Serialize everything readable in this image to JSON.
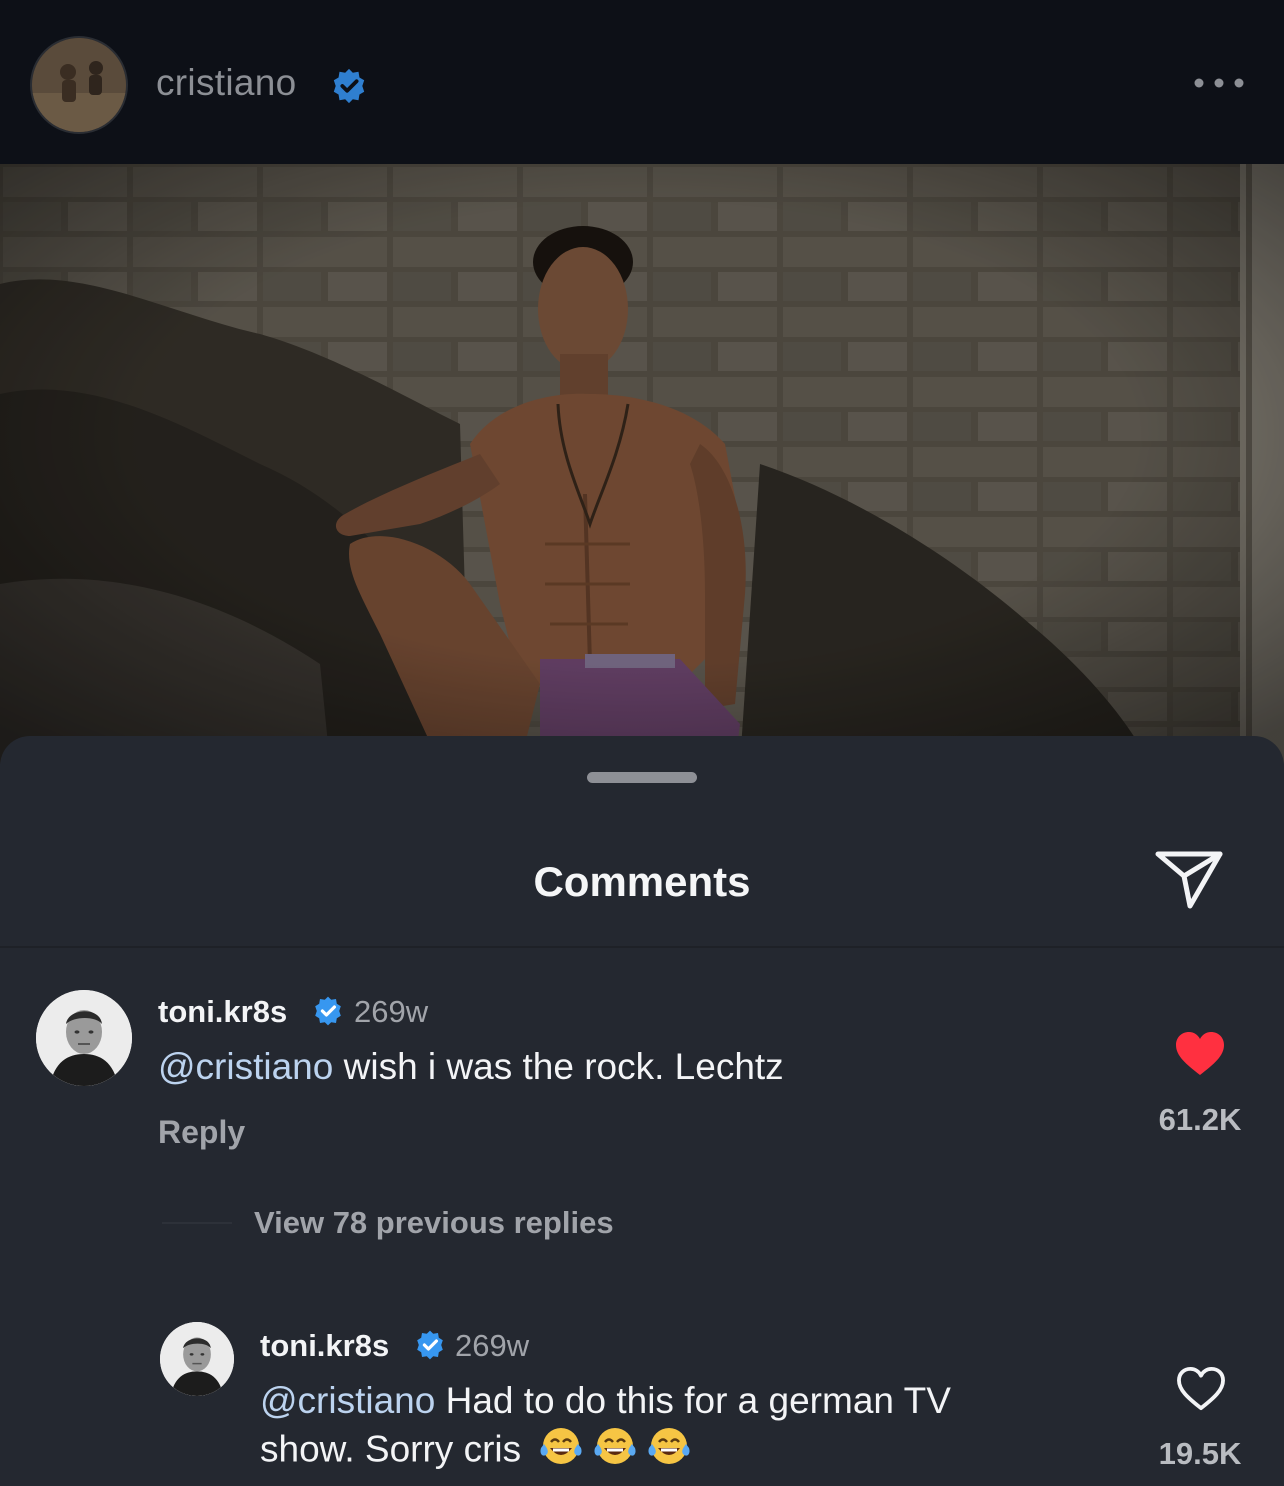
{
  "post": {
    "username": "cristiano",
    "verified": true,
    "more_icon": "more-horizontal-icon"
  },
  "sheet": {
    "title": "Comments",
    "share_icon": "paper-plane-icon"
  },
  "comments": [
    {
      "username": "toni.kr8s",
      "verified": true,
      "time": "269w",
      "mention": "@cristiano",
      "text": " wish i was the rock. Lechtz",
      "reply_label": "Reply",
      "liked": true,
      "like_count": "61.2K"
    }
  ],
  "view_replies": "View 78 previous replies",
  "replies": [
    {
      "username": "toni.kr8s",
      "verified": true,
      "time": "269w",
      "mention": "@cristiano",
      "text_line1": " Had to do this for a german TV",
      "text_line2": "show. Sorry cris",
      "emojis": [
        "face-with-tears-of-joy",
        "face-with-tears-of-joy",
        "face-with-tears-of-joy"
      ],
      "liked": false,
      "like_count": "19.5K"
    }
  ],
  "colors": {
    "header_bg": "#0d1017",
    "sheet_bg": "#242830",
    "verified": "#3797f0",
    "like_red": "#ff3040",
    "mention": "#bcd3ef"
  }
}
